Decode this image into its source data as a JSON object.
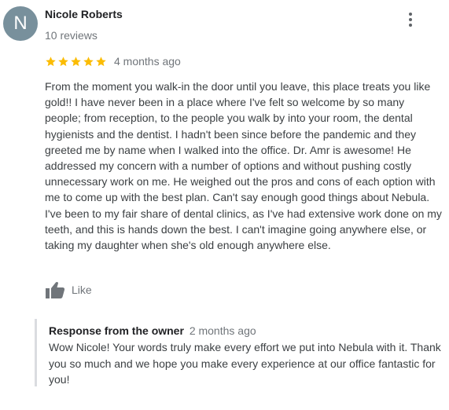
{
  "review": {
    "avatar_letter": "N",
    "avatar_color": "#78909c",
    "reviewer_name": "Nicole Roberts",
    "review_count": "10 reviews",
    "rating": 5,
    "rating_max": 5,
    "star_color": "#fbbc04",
    "date": "4 months ago",
    "text": "From the moment you walk-in the door until you leave, this place treats you like gold!! I have never been in a place where I've felt so welcome by so many people; from reception, to the people you walk by into your room, the dental hygienists and the dentist. I hadn't been since before the pandemic and they greeted me by name when I walked into the office. Dr. Amr is awesome! He addressed my concern with a number of options and without pushing costly unnecessary work on me. He weighed out the pros and cons of each option with me to come up with the best plan. Can't say enough good things about Nebula. I've been to my fair share of dental clinics, as I've had extensive work done on my teeth, and this is hands down the best. I can't imagine going anywhere else, or taking my daughter when she's old enough anywhere else.",
    "like_label": "Like",
    "more_icon": "more-vertical-icon",
    "like_icon": "thumbs-up-icon"
  },
  "owner_response": {
    "title": "Response from the owner",
    "date": "2 months ago",
    "text": "Wow Nicole! Your words truly make every effort we put into Nebula with it. Thank you so much and we hope you make every experience at our office fantastic for you!"
  }
}
